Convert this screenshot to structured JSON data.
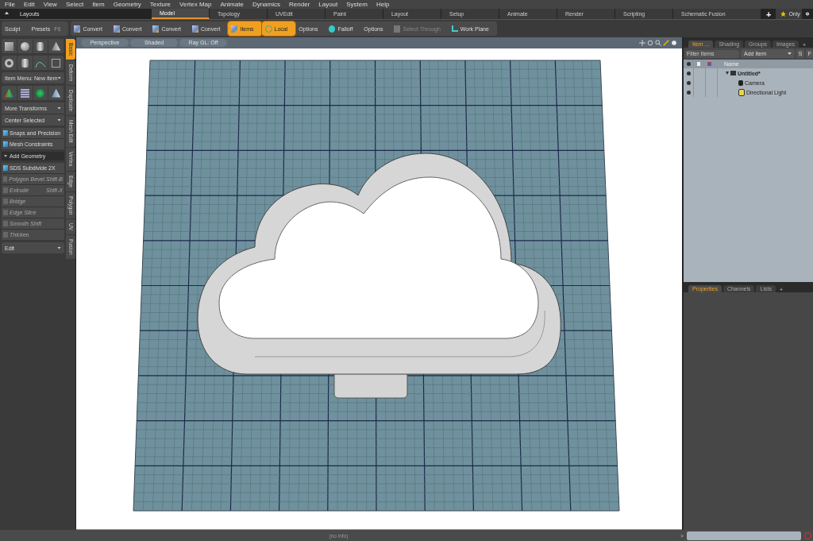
{
  "menu_bar": [
    "File",
    "Edit",
    "View",
    "Select",
    "Item",
    "Geometry",
    "Texture",
    "Vertex Map",
    "Animate",
    "Dynamics",
    "Render",
    "Layout",
    "System",
    "Help"
  ],
  "layouts_bar": {
    "label": "Layouts",
    "tabs": [
      {
        "label": "Model",
        "selected": true
      },
      {
        "label": "Topology",
        "selected": false
      },
      {
        "label": "UVEdit",
        "selected": false
      },
      {
        "label": "Paint",
        "selected": false
      },
      {
        "label": "Layout",
        "selected": false
      },
      {
        "label": "Setup",
        "selected": false
      },
      {
        "label": "Animate",
        "selected": false
      },
      {
        "label": "Render",
        "selected": false
      },
      {
        "label": "Scripting",
        "selected": false
      },
      {
        "label": "Schematic Fusion",
        "selected": false
      }
    ],
    "add": "+",
    "filter": "Only"
  },
  "toolbar": {
    "sculpt": "Sculpt",
    "presets": "Presets",
    "presets_shortcut": "F6",
    "tools": [
      {
        "kind": "convert",
        "label": "Convert",
        "selected": false,
        "disabled": false
      },
      {
        "kind": "convert",
        "label": "Convert",
        "selected": false,
        "disabled": false
      },
      {
        "kind": "convert",
        "label": "Convert",
        "selected": false,
        "disabled": false
      },
      {
        "kind": "convert",
        "label": "Convert",
        "selected": false,
        "disabled": false
      },
      {
        "kind": "items",
        "label": "Items",
        "selected": true,
        "disabled": false
      },
      {
        "kind": "local",
        "label": "Local",
        "selected": true,
        "disabled": false
      },
      {
        "kind": "plain",
        "label": "Options",
        "selected": false,
        "disabled": false
      },
      {
        "kind": "falloff",
        "label": "Falloff",
        "selected": false,
        "disabled": false
      },
      {
        "kind": "plain",
        "label": "Options",
        "selected": false,
        "disabled": false
      },
      {
        "kind": "select",
        "label": "Select Through",
        "selected": false,
        "disabled": true
      },
      {
        "kind": "workplane",
        "label": "Work Plane",
        "selected": false,
        "disabled": false
      }
    ]
  },
  "left_panel": {
    "item_menu": "Item Menu: New Item",
    "dropdowns": [
      "More Transforms",
      "Center Selected"
    ],
    "buttons": [
      "Snaps and Precision",
      "Mesh Constraints"
    ],
    "section": "Add Geometry",
    "tools": [
      {
        "label": "SDS Subdivide 2X",
        "disabled": false
      },
      {
        "label": "Polygon Bevel",
        "shortcut": "Shift-B",
        "disabled": true
      },
      {
        "label": "Extrude",
        "shortcut": "Shift-X",
        "disabled": true
      },
      {
        "label": "Bridge",
        "disabled": true
      },
      {
        "label": "Edge Slice",
        "disabled": true
      },
      {
        "label": "Smooth Shift",
        "disabled": true
      },
      {
        "label": "Thicken",
        "disabled": true
      }
    ],
    "edit": "Edit"
  },
  "side_tabs": [
    {
      "label": "Basic",
      "selected": true
    },
    {
      "label": "Deform",
      "selected": false
    },
    {
      "label": "Duplicate",
      "selected": false
    },
    {
      "label": "Mesh Edit",
      "selected": false
    },
    {
      "label": "Vertex",
      "selected": false
    },
    {
      "label": "Edge",
      "selected": false
    },
    {
      "label": "Polygon",
      "selected": false
    },
    {
      "label": "UV",
      "selected": false
    },
    {
      "label": "Fusion",
      "selected": false
    }
  ],
  "viewport": {
    "header": [
      "Perspective",
      "Shaded",
      "Ray GL: Off"
    ]
  },
  "item_list": {
    "tabs": [
      {
        "label": "Item ...",
        "selected": true
      },
      {
        "label": "Shading",
        "selected": false
      },
      {
        "label": "Groups",
        "selected": false
      },
      {
        "label": "Images",
        "selected": false
      }
    ],
    "add": "+",
    "filter_placeholder": "Filter Items",
    "add_item": "Add Item",
    "buttons": [
      "S",
      "F"
    ],
    "column": "Name",
    "tree": [
      {
        "name": "Untitled*",
        "expanded": true,
        "children": [
          {
            "name": "Camera",
            "kind": "camera"
          },
          {
            "name": "Directional Light",
            "kind": "light"
          }
        ]
      }
    ]
  },
  "properties": {
    "tabs": [
      {
        "label": "Properties",
        "selected": true
      },
      {
        "label": "Channels",
        "selected": false
      },
      {
        "label": "Lists",
        "selected": false
      }
    ],
    "add": "+"
  },
  "status_bar": {
    "text": "(no info)",
    "prompt": ">"
  }
}
